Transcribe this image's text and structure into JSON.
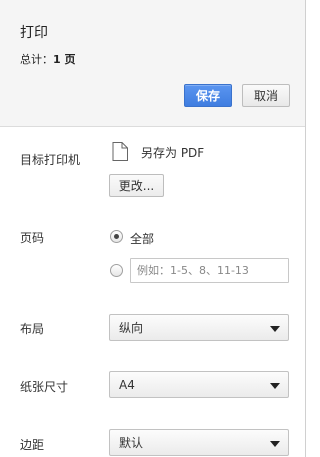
{
  "header": {
    "title": "打印",
    "total_prefix": "总计：",
    "total_value": "1 页",
    "save_label": "保存",
    "cancel_label": "取消"
  },
  "destination": {
    "label": "目标打印机",
    "name": "另存为 PDF",
    "change_label": "更改..."
  },
  "pages": {
    "label": "页码",
    "all_label": "全部",
    "selected": "all",
    "custom_placeholder": "例如：1-5、8、11-13"
  },
  "layout": {
    "label": "布局",
    "value": "纵向"
  },
  "paper_size": {
    "label": "纸张尺寸",
    "value": "A4"
  },
  "margins": {
    "label": "边距",
    "value": "默认"
  },
  "colors": {
    "accent": "#4285f4",
    "header_bg": "#f5f5f5"
  },
  "icons": {
    "destination": "document-icon",
    "dropdown": "dropdown-arrow-icon"
  }
}
